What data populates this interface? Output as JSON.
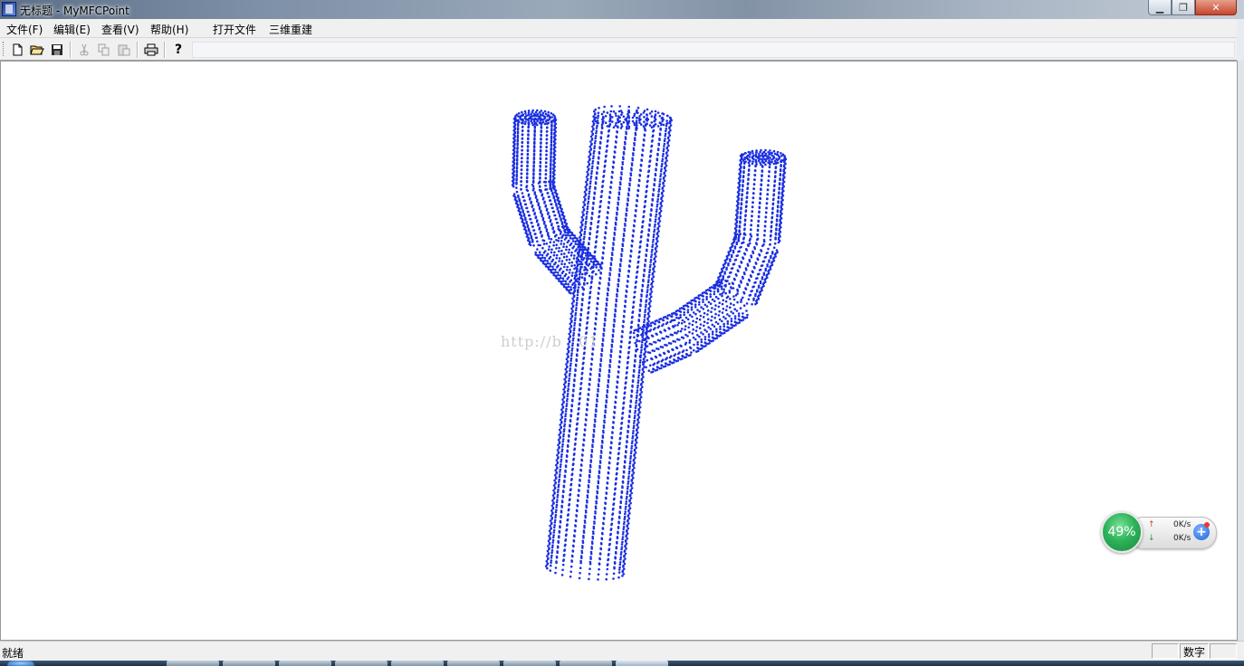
{
  "window": {
    "title": "无标题 - MyMFCPoint",
    "app_icon": "mfc-app-icon",
    "controls": {
      "minimize": "minimize-icon",
      "maximize": "restore-icon",
      "close": "close-icon"
    }
  },
  "menu": {
    "items": [
      "文件(F)",
      "编辑(E)",
      "查看(V)",
      "帮助(H)",
      "打开文件",
      "三维重建"
    ]
  },
  "toolbar": {
    "buttons": [
      {
        "icon": "new-file-icon",
        "enabled": true
      },
      {
        "icon": "open-folder-icon",
        "enabled": true
      },
      {
        "icon": "save-icon",
        "enabled": true
      },
      {
        "icon": "cut-icon",
        "enabled": false
      },
      {
        "icon": "copy-icon",
        "enabled": false
      },
      {
        "icon": "paste-icon",
        "enabled": false
      },
      {
        "icon": "print-icon",
        "enabled": true
      },
      {
        "icon": "help-icon",
        "enabled": true
      }
    ]
  },
  "view": {
    "point_color": "#1a2ee0",
    "watermark": "http://b      .     01",
    "content": "cactus point cloud"
  },
  "net_widget": {
    "percent": "49%",
    "upload": "0K/s",
    "download": "0K/s"
  },
  "status": {
    "text": "就绪",
    "num_indicator": "数字"
  }
}
